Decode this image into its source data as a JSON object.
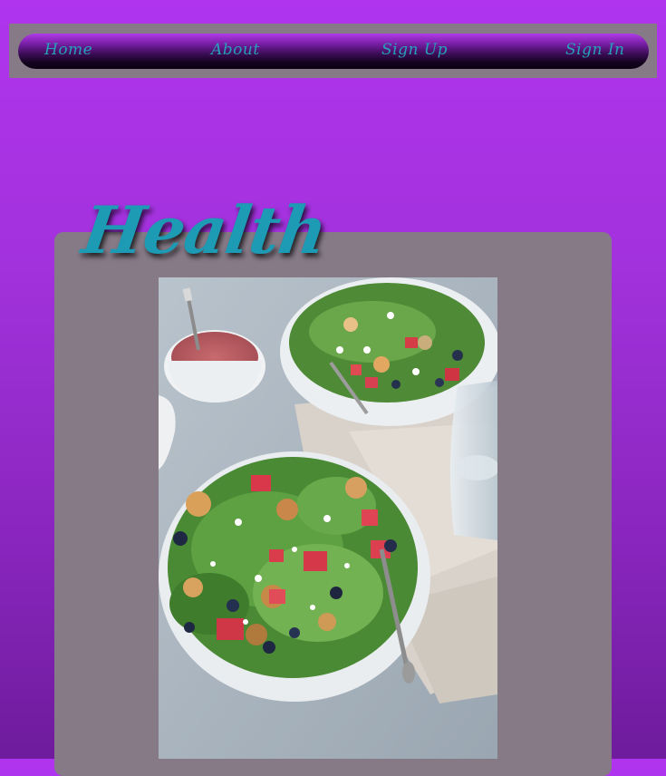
{
  "nav": {
    "items": [
      {
        "label": "Home"
      },
      {
        "label": "About"
      },
      {
        "label": "Sign Up"
      },
      {
        "label": "Sign In"
      }
    ]
  },
  "main": {
    "heading": "Health"
  },
  "colors": {
    "background": "#a232dc",
    "panel": "#867a86",
    "accent_text": "#1d9ab4",
    "nav_link": "#27a0b8"
  },
  "image": {
    "subject": "salad-photo"
  }
}
